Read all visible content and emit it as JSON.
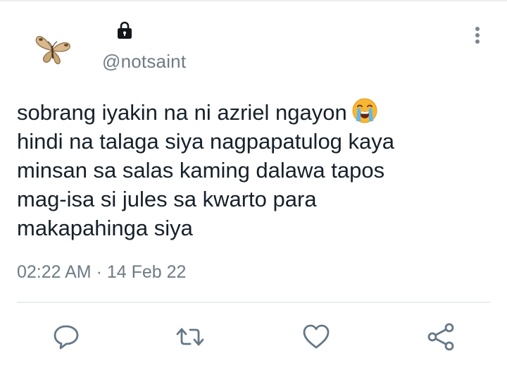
{
  "tweet": {
    "handle": "@notsaint",
    "text_lines": [
      "sobrang iyakin na ni azriel ngayon",
      "hindi na talaga siya nagpapatulog kaya",
      "minsan sa salas kaming dalawa tapos",
      "mag-isa si jules sa kwarto para",
      "makapahinga siya"
    ],
    "emoji": "loudly-crying-face",
    "time": "02:22 AM",
    "separator": "·",
    "date": "14 Feb 22"
  },
  "icons": {
    "avatar": "butterfly-avatar",
    "protected": "lock-icon",
    "more": "more-vertical-icon",
    "actions": [
      "reply-icon",
      "retweet-icon",
      "like-icon",
      "share-icon"
    ]
  },
  "colors": {
    "text": "#16202a",
    "muted": "#6e7b85",
    "icon": "#657786",
    "divider": "#e6ecf0"
  }
}
